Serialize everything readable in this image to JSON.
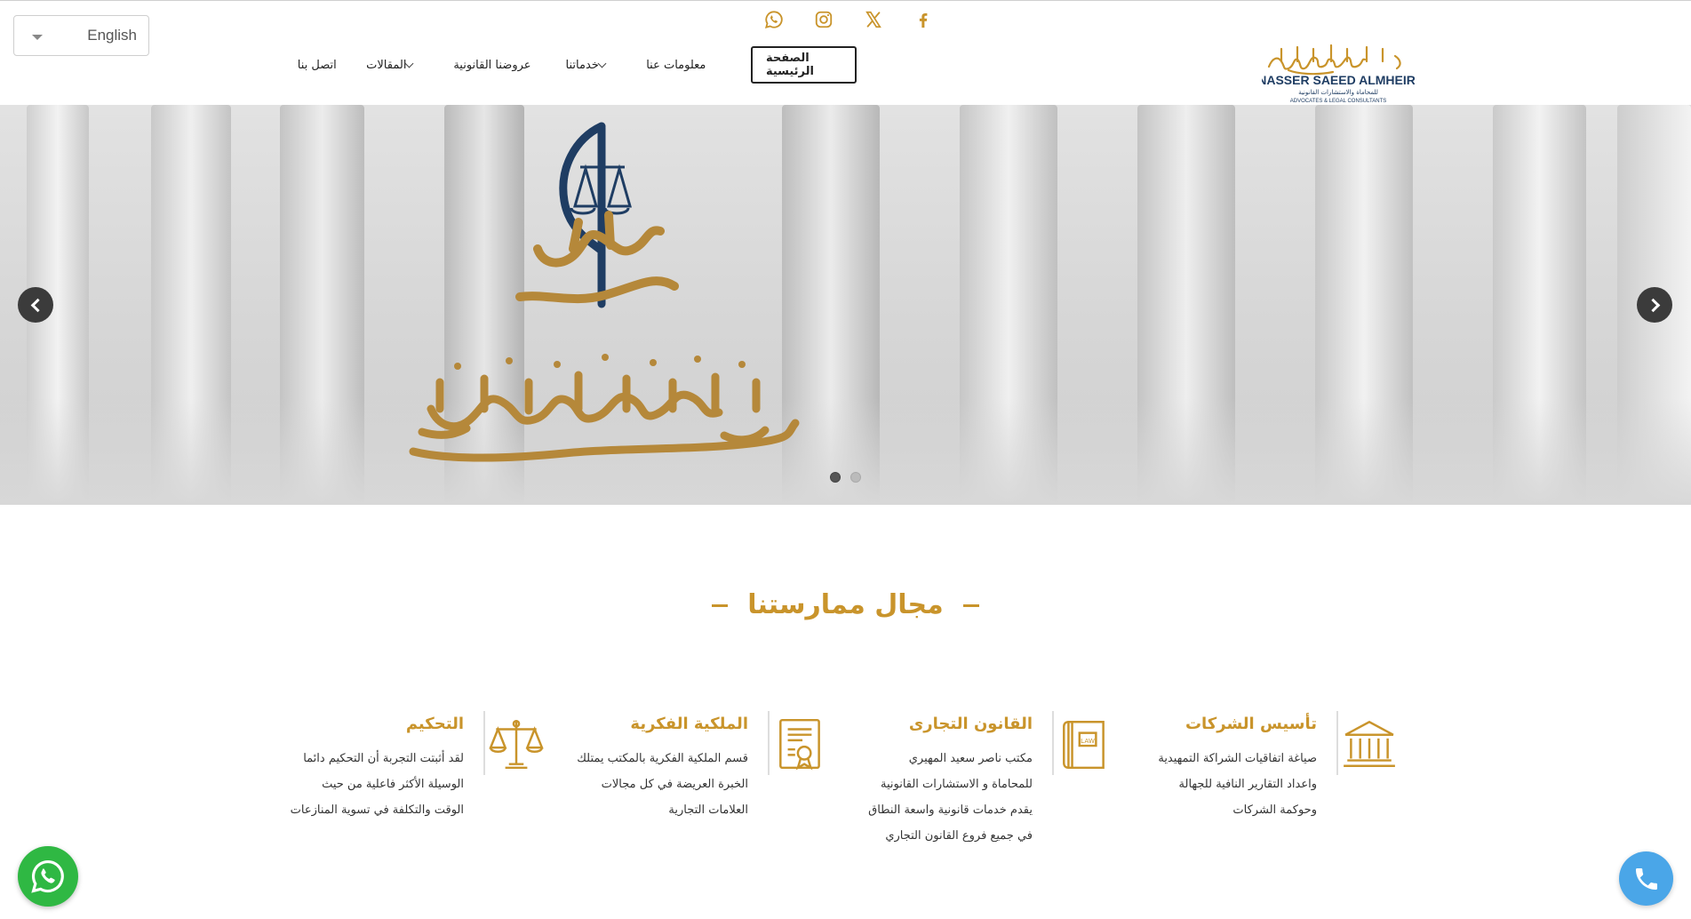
{
  "language": {
    "selected": "English"
  },
  "social": {
    "items": [
      "whatsapp-icon",
      "instagram-icon",
      "x-icon",
      "facebook-icon"
    ],
    "color": "#c9942b"
  },
  "nav": {
    "items": [
      {
        "label": "الصفحة الرئيسية",
        "active": true,
        "dropdown": false
      },
      {
        "label": "معلومات عنا",
        "active": false,
        "dropdown": false
      },
      {
        "label": "خدماتنا",
        "active": false,
        "dropdown": true
      },
      {
        "label": "عروضنا القانونية",
        "active": false,
        "dropdown": false
      },
      {
        "label": "المقالات",
        "active": false,
        "dropdown": true
      },
      {
        "label": "اتصل بنا",
        "active": false,
        "dropdown": false
      }
    ]
  },
  "brand": {
    "arabic": "ناصر سعيد المهيري",
    "english": "NASSER SAEED ALMHEIRI",
    "sub_arabic": "للمحاماة والاستشارات القانونية",
    "sub_english": "ADVOCATES & LEGAL CONSULTANTS",
    "gold": "#c9942b",
    "navy": "#1f3d63"
  },
  "hero": {
    "emblem_word": "مهيري",
    "emblem_name": "ناصر سعيد المهيري",
    "slides": 2,
    "active_slide": 1
  },
  "section": {
    "title": "مجال ممارستنا"
  },
  "practices": [
    {
      "title": "تأسيس الشركات",
      "icon": "bank-building-icon",
      "lines": [
        "صياغة اتفاقيات الشراكة التمهيدية",
        "واعداد التقارير النافية للجهالة",
        "وحوكمة الشركات"
      ]
    },
    {
      "title": "القانون التجارى",
      "icon": "law-book-icon",
      "lines": [
        "مكتب ناصر سعيد المهيري",
        "للمحاماة و الاستشارات القانونية",
        "يقدم خدمات قانونية واسعة النطاق",
        "في جميع فروع القانون التجاري"
      ]
    },
    {
      "title": "الملكية الفكرية",
      "icon": "certificate-icon",
      "lines": [
        "قسم الملكية الفكرية بالمكتب يمتلك",
        "الخبرة العريضة في كل مجالات",
        "العلامات التجارية"
      ]
    },
    {
      "title": "التحكيم",
      "icon": "scales-icon",
      "lines": [
        "لقد أثبتت التجربة أن التحكيم دائما",
        "الوسيلة الأكثر فاعلية من حيث",
        "الوقت والتكلفة في تسوية المنازعات"
      ]
    }
  ]
}
